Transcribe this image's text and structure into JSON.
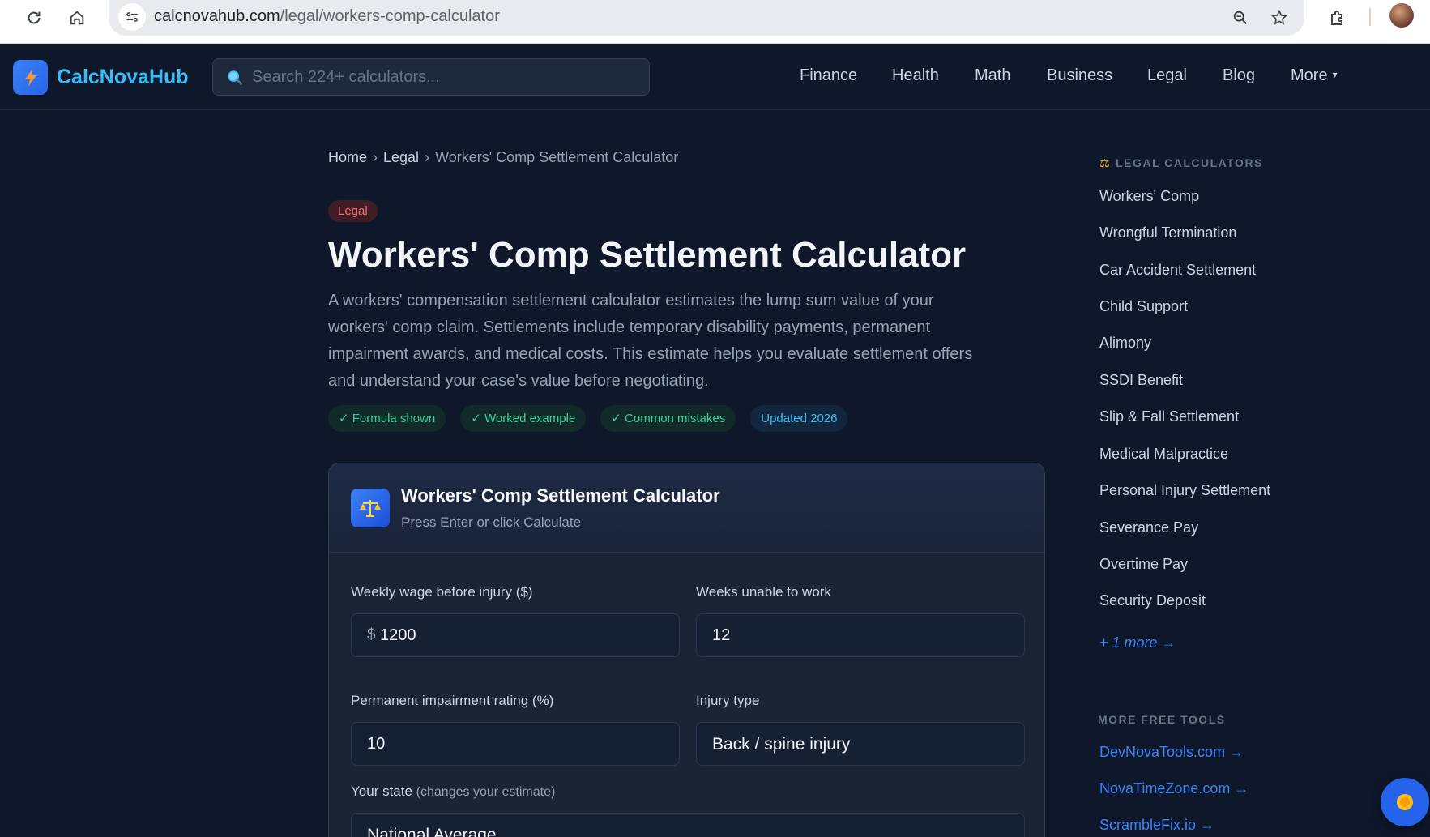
{
  "browser": {
    "url_host": "calcnovahub.com",
    "url_path": "/legal/workers-comp-calculator"
  },
  "site": {
    "brand": "CalcNovaHub",
    "search_placeholder": "Search 224+ calculators...",
    "nav": [
      "Finance",
      "Health",
      "Math",
      "Business",
      "Legal",
      "Blog"
    ],
    "nav_more": "More"
  },
  "breadcrumb": {
    "home": "Home",
    "section": "Legal",
    "current": "Workers' Comp Settlement Calculator",
    "separator": "›"
  },
  "page": {
    "category_badge": "Legal",
    "title": "Workers' Comp Settlement Calculator",
    "intro": "A workers' compensation settlement calculator estimates the lump sum value of your workers' comp claim. Settlements include temporary disability payments, permanent impairment awards, and medical costs. This estimate helps you evaluate settlement offers and understand your case's value before negotiating.",
    "pills": [
      "✓ Formula shown",
      "✓ Worked example",
      "✓ Common mistakes"
    ],
    "updated_pill": "Updated 2026"
  },
  "calculator": {
    "title": "Workers' Comp Settlement Calculator",
    "subtitle": "Press Enter or click Calculate",
    "fields": {
      "weekly_wage": {
        "label": "Weekly wage before injury ($)",
        "prefix": "$",
        "value": "1200"
      },
      "weeks_unable": {
        "label": "Weeks unable to work",
        "value": "12"
      },
      "impairment": {
        "label": "Permanent impairment rating (%)",
        "value": "10"
      },
      "injury_type": {
        "label": "Injury type",
        "value": "Back / spine injury"
      },
      "state": {
        "label": "Your state",
        "hint": "(changes your estimate)",
        "value": "National Average"
      }
    }
  },
  "sidebar": {
    "heading": "LEGAL CALCULATORS",
    "items": [
      "Workers' Comp",
      "Wrongful Termination",
      "Car Accident Settlement",
      "Child Support",
      "Alimony",
      "SSDI Benefit",
      "Slip & Fall Settlement",
      "Medical Malpractice",
      "Personal Injury Settlement",
      "Severance Pay",
      "Overtime Pay",
      "Security Deposit"
    ],
    "more_link": "+ 1 more →",
    "tools_heading": "MORE FREE TOOLS",
    "tools": [
      "DevNovaTools.com →",
      "NovaTimeZone.com →",
      "ScrambleFix.io →"
    ]
  },
  "colors": {
    "background": "#0f172a",
    "accent": "#38bdf8",
    "link": "#3b82f6",
    "success": "#34d399",
    "danger": "#f87171"
  },
  "icons": {
    "reload": "reload-icon",
    "home": "home-icon",
    "site_settings": "site-settings-icon",
    "zoom": "zoom-icon",
    "bookmark": "star-icon",
    "extensions": "puzzle-icon",
    "logo": "lightning-icon",
    "search": "magnifier-icon",
    "calculator": "scales-icon",
    "floating": "sun-icon"
  }
}
